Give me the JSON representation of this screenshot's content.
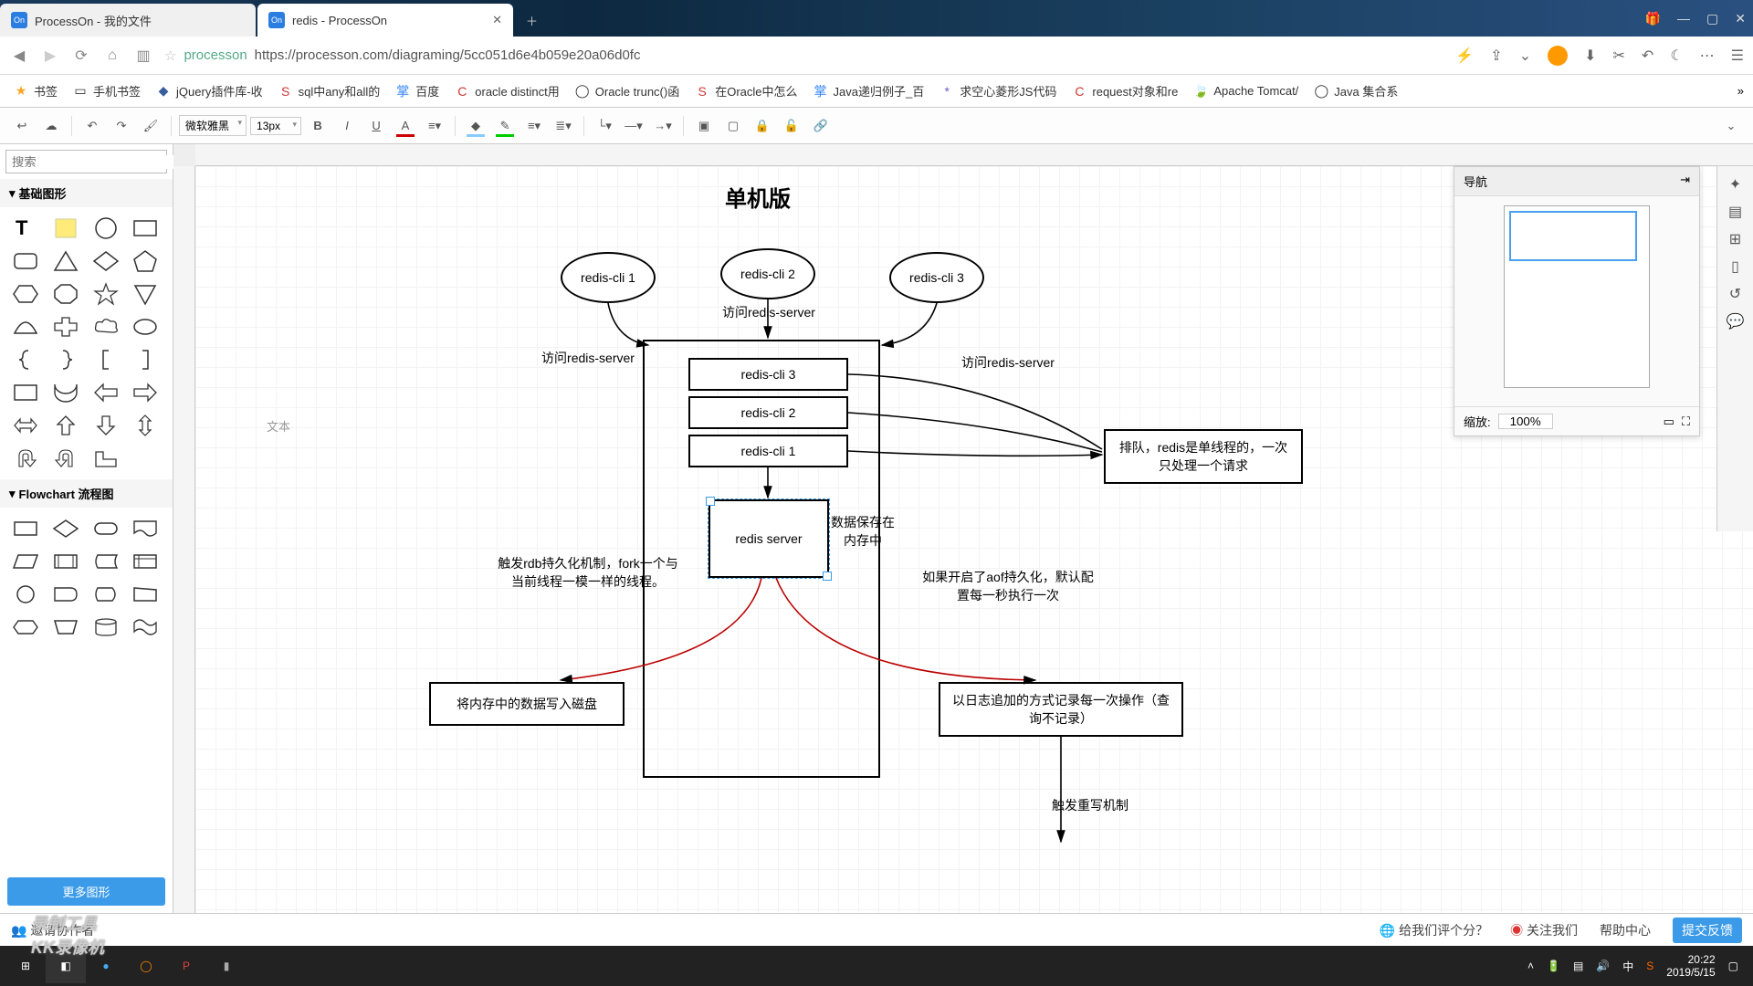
{
  "tabs": [
    {
      "label": "ProcessOn - 我的文件",
      "active": false
    },
    {
      "label": "redis - ProcessOn",
      "active": true
    }
  ],
  "url": {
    "host": "processon",
    "path": "https://processon.com/diagraming/5cc051d6e4b059e20a06d0fc"
  },
  "bookmarks": [
    {
      "icon": "★",
      "label": "书签",
      "color": "#f5a623"
    },
    {
      "icon": "▭",
      "label": "手机书签",
      "color": "#888"
    },
    {
      "icon": "◆",
      "label": "jQuery插件库-收",
      "color": "#375d9e"
    },
    {
      "icon": "S",
      "label": "sql中any和all的",
      "color": "#cb3837"
    },
    {
      "icon": "掌",
      "label": "百度",
      "color": "#3385ff"
    },
    {
      "icon": "C",
      "label": "oracle distinct用",
      "color": "#cb3837"
    },
    {
      "icon": "◯",
      "label": "Oracle trunc()函",
      "color": "#888"
    },
    {
      "icon": "S",
      "label": "在Oracle中怎么",
      "color": "#cb3837"
    },
    {
      "icon": "掌",
      "label": "Java递归例子_百",
      "color": "#3385ff"
    },
    {
      "icon": "*",
      "label": "求空心菱形JS代码",
      "color": "#6a5acd"
    },
    {
      "icon": "C",
      "label": "request对象和re",
      "color": "#cb3837"
    },
    {
      "icon": "🍃",
      "label": "Apache Tomcat/",
      "color": "#ffcc00"
    },
    {
      "icon": "◯",
      "label": "Java 集合系",
      "color": "#888"
    }
  ],
  "toolbar": {
    "font_family": "微软雅黑",
    "font_size": "13px"
  },
  "shape_groups": {
    "basic": "基础图形",
    "flowchart": "Flowchart 流程图"
  },
  "sidebar": {
    "search_placeholder": "搜索",
    "more_shapes": "更多图形"
  },
  "nav": {
    "title": "导航",
    "zoom_label": "缩放:",
    "zoom_value": "100%"
  },
  "status": {
    "invite": "邀请协作者",
    "rate": "给我们评个分？",
    "follow": "关注我们",
    "help": "帮助中心",
    "feedback": "提交反馈"
  },
  "taskbar": {
    "time": "20:22",
    "date": "2019/5/15"
  },
  "watermark": {
    "line1": "录制工具",
    "line2": "KK录像机"
  },
  "canvas_cursor_text": "文本",
  "diagram": {
    "title": "单机版",
    "nodes": {
      "cli1_e": "redis-cli 1",
      "cli2_e": "redis-cli 2",
      "cli3_e": "redis-cli 3",
      "visit1": "访问redis-server",
      "visit2": "访问redis-server",
      "visit3": "访问redis-server",
      "q_cli3": "redis-cli 3",
      "q_cli2": "redis-cli 2",
      "q_cli1": "redis-cli 1",
      "server": "redis server",
      "mem_label": "数据保存在内存中",
      "queue_note": "排队，redis是单线程的，一次只处理一个请求",
      "rdb_label": "触发rdb持久化机制，fork一个与当前线程一模一样的线程。",
      "aof_label": "如果开启了aof持久化，默认配置每一秒执行一次",
      "disk_box": "将内存中的数据写入磁盘",
      "log_box": "以日志追加的方式记录每一次操作（查询不记录）",
      "rewrite": "触发重写机制"
    }
  }
}
